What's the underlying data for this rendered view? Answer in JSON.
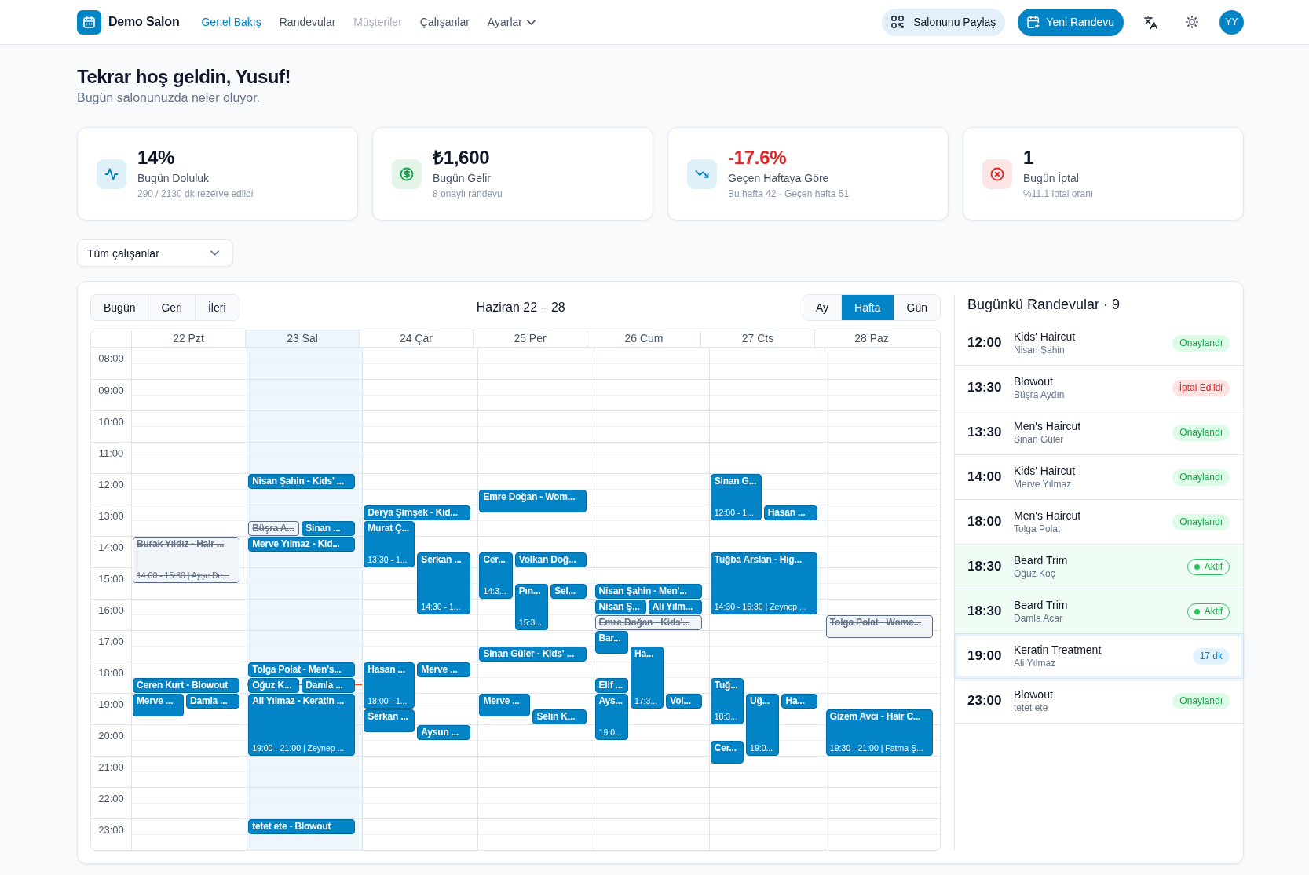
{
  "header": {
    "brand": "Demo Salon",
    "nav": [
      {
        "label": "Genel Bakış",
        "selected": true,
        "disabled": false,
        "dropdown": false
      },
      {
        "label": "Randevular",
        "selected": false,
        "disabled": false,
        "dropdown": false
      },
      {
        "label": "Müşteriler",
        "selected": false,
        "disabled": true,
        "dropdown": false
      },
      {
        "label": "Çalışanlar",
        "selected": false,
        "disabled": false,
        "dropdown": false
      },
      {
        "label": "Ayarlar",
        "selected": false,
        "disabled": false,
        "dropdown": true
      }
    ],
    "share_button": "Salonunu Paylaş",
    "new_button": "Yeni Randevu",
    "avatar": "YY"
  },
  "welcome": {
    "title": "Tekrar hoş geldin, Yusuf!",
    "subtitle": "Bugün salonunuzda neler oluyor."
  },
  "stats": [
    {
      "kind": "activity",
      "value": "14%",
      "negative": false,
      "label": "Bugün Doluluk",
      "detail": "290 / 2130 dk rezerve edildi"
    },
    {
      "kind": "money",
      "value": "₺1,600",
      "negative": false,
      "label": "Bugün Gelir",
      "detail": "8 onaylı randevu"
    },
    {
      "kind": "trend-down",
      "value": "-17.6%",
      "negative": true,
      "label": "Geçen Haftaya Göre",
      "detail": "Bu hafta 42 · Geçen hafta 51"
    },
    {
      "kind": "cancel",
      "value": "1",
      "negative": false,
      "label": "Bugün İptal",
      "detail": "%11.1 iptal oranı"
    }
  ],
  "staff_filter": {
    "value": "Tüm çalışanlar"
  },
  "calendar": {
    "nav_buttons": [
      "Bugün",
      "Geri",
      "İleri"
    ],
    "title": "Haziran 22 – 28",
    "views": [
      {
        "label": "Ay",
        "selected": false
      },
      {
        "label": "Hafta",
        "selected": true
      },
      {
        "label": "Gün",
        "selected": false
      }
    ],
    "hours": [
      "08:00",
      "09:00",
      "10:00",
      "11:00",
      "12:00",
      "13:00",
      "14:00",
      "15:00",
      "16:00",
      "17:00",
      "18:00",
      "19:00",
      "20:00",
      "21:00",
      "22:00",
      "23:00"
    ],
    "days": [
      {
        "label": "22 Pzt",
        "today": false,
        "events": [
          {
            "title": "Burak Yıldız - Hair ...",
            "subtitle": "14:00 - 15:30 | Ayşe De...",
            "cancelled": true
          },
          {
            "title": "Ceren Kurt - Blowout",
            "cancelled": false
          },
          {
            "title": "Merve ...",
            "cancelled": false
          },
          {
            "title": "Damla ...",
            "cancelled": false
          }
        ]
      },
      {
        "label": "23 Sal",
        "today": true,
        "events": [
          {
            "title": "Nisan Şahin - Kids' ...",
            "cancelled": false
          },
          {
            "title": "Büşra A...",
            "cancelled": true
          },
          {
            "title": "Sinan ...",
            "cancelled": false
          },
          {
            "title": "Merve Yılmaz - Kid...",
            "cancelled": false
          },
          {
            "title": "Tolga Polat - Men's...",
            "cancelled": false
          },
          {
            "title": "Oğuz K...",
            "cancelled": false
          },
          {
            "title": "Damla ...",
            "cancelled": false
          },
          {
            "title": "Ali Yılmaz - Keratin ...",
            "subtitle": "19:00 - 21:00 | Zeynep ...",
            "cancelled": false
          },
          {
            "title": "tetet ete - Blowout",
            "cancelled": false
          }
        ]
      },
      {
        "label": "24 Çar",
        "today": false,
        "events": [
          {
            "title": "Derya Şimşek - Kid...",
            "cancelled": false
          },
          {
            "title": "Murat Ç...",
            "subtitle": "13:30 - 1...",
            "cancelled": false
          },
          {
            "title": "Serkan ...",
            "subtitle": "14:30 - 1...",
            "cancelled": false
          },
          {
            "title": "Hasan ...",
            "subtitle": "18:00 - 1...",
            "cancelled": false
          },
          {
            "title": "Merve ...",
            "cancelled": false
          },
          {
            "title": "Serkan ...",
            "cancelled": false
          },
          {
            "title": "Aysun ...",
            "cancelled": false
          }
        ]
      },
      {
        "label": "25 Per",
        "today": false,
        "events": [
          {
            "title": "Emre Doğan - Wom...",
            "cancelled": false
          },
          {
            "title": "Cer...",
            "subtitle": "14:3...",
            "cancelled": false
          },
          {
            "title": "Volkan Doğ...",
            "cancelled": false
          },
          {
            "title": "Pın...",
            "subtitle": "15:3...",
            "cancelled": false
          },
          {
            "title": "Sel...",
            "cancelled": false
          },
          {
            "title": "Sinan Güler - Kids' ...",
            "cancelled": false
          },
          {
            "title": "Merve ...",
            "cancelled": false
          },
          {
            "title": "Selin K...",
            "cancelled": false
          }
        ]
      },
      {
        "label": "26 Cum",
        "today": false,
        "events": [
          {
            "title": "Nisan Şahin - Men'...",
            "cancelled": false
          },
          {
            "title": "Nisan Ş...",
            "cancelled": false
          },
          {
            "title": "Ali Yılm...",
            "cancelled": false
          },
          {
            "title": "Emre Doğan - Kids'...",
            "cancelled": true
          },
          {
            "title": "Bar...",
            "cancelled": false
          },
          {
            "title": "Ha...",
            "subtitle": "17:3...",
            "cancelled": false
          },
          {
            "title": "Elif ...",
            "cancelled": false
          },
          {
            "title": "Ays...",
            "subtitle": "19:0...",
            "cancelled": false
          },
          {
            "title": "Vol...",
            "cancelled": false
          }
        ]
      },
      {
        "label": "27 Cts",
        "today": false,
        "events": [
          {
            "title": "Sinan G...",
            "subtitle": "12:00 - 1...",
            "cancelled": false
          },
          {
            "title": "Hasan ...",
            "cancelled": false
          },
          {
            "title": "Tuğba Arslan - Hig...",
            "subtitle": "14:30 - 16:30 | Zeynep ...",
            "cancelled": false
          },
          {
            "title": "Tuğ...",
            "subtitle": "18:3...",
            "cancelled": false
          },
          {
            "title": "Uğ...",
            "subtitle": "19:0...",
            "cancelled": false
          },
          {
            "title": "Ha...",
            "cancelled": false
          },
          {
            "title": "Cer...",
            "cancelled": false
          }
        ]
      },
      {
        "label": "28 Paz",
        "today": false,
        "events": [
          {
            "title": "Tolga Polat - Wome...",
            "cancelled": true
          },
          {
            "title": "Gizem Avcı - Hair C...",
            "subtitle": "19:30 - 21:00 | Fatma Ş...",
            "cancelled": false
          }
        ]
      }
    ]
  },
  "today_panel": {
    "title": "Bugünkü Randevular · 9",
    "appointments": [
      {
        "time": "12:00",
        "service": "Kids' Haircut",
        "client": "Nisan Şahin",
        "status": "Onaylandı",
        "kind": "confirmed"
      },
      {
        "time": "13:30",
        "service": "Blowout",
        "client": "Büşra Aydın",
        "status": "İptal Edildi",
        "kind": "cancelled"
      },
      {
        "time": "13:30",
        "service": "Men's Haircut",
        "client": "Sinan Güler",
        "status": "Onaylandı",
        "kind": "confirmed"
      },
      {
        "time": "14:00",
        "service": "Kids' Haircut",
        "client": "Merve Yılmaz",
        "status": "Onaylandı",
        "kind": "confirmed"
      },
      {
        "time": "18:00",
        "service": "Men's Haircut",
        "client": "Tolga Polat",
        "status": "Onaylandı",
        "kind": "confirmed"
      },
      {
        "time": "18:30",
        "service": "Beard Trim",
        "client": "Oğuz Koç",
        "status": "Aktif",
        "kind": "active"
      },
      {
        "time": "18:30",
        "service": "Beard Trim",
        "client": "Damla Acar",
        "status": "Aktif",
        "kind": "active"
      },
      {
        "time": "19:00",
        "service": "Keratin Treatment",
        "client": "Ali Yılmaz",
        "status": "17 dk",
        "kind": "upcoming"
      },
      {
        "time": "23:00",
        "service": "Blowout",
        "client": "tetet ete",
        "status": "Onaylandı",
        "kind": "confirmed"
      }
    ]
  }
}
